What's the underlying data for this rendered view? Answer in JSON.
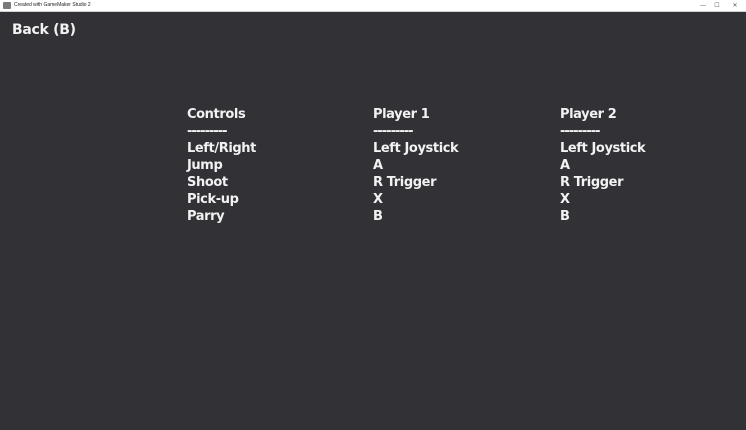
{
  "window": {
    "title": "Created with GameMaker Studio 2",
    "minimize_glyph": "—",
    "maximize_glyph": "☐",
    "close_glyph": "✕"
  },
  "back_label": "Back (B)",
  "table": {
    "columns": [
      {
        "header": "Controls",
        "divider": "---------",
        "rows": [
          "Left/Right",
          "Jump",
          "Shoot",
          "Pick-up",
          "Parry"
        ]
      },
      {
        "header": "Player 1",
        "divider": "---------",
        "rows": [
          "Left Joystick",
          "A",
          "R Trigger",
          "X",
          "B"
        ]
      },
      {
        "header": "Player 2",
        "divider": "---------",
        "rows": [
          "Left Joystick",
          "A",
          "R Trigger",
          "X",
          "B"
        ]
      }
    ]
  },
  "colors": {
    "background": "#323135",
    "text": "#f2f2f2"
  }
}
